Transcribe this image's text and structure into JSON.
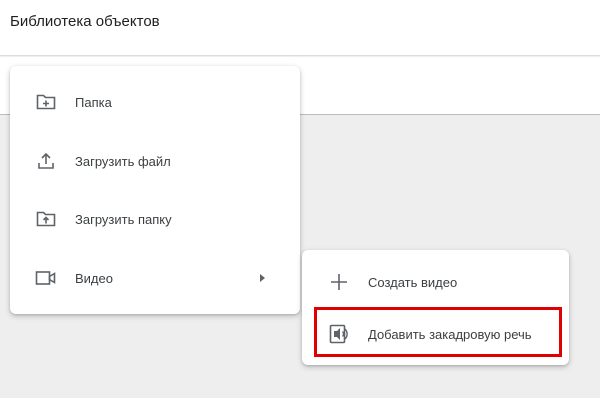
{
  "header": {
    "title": "Библиотека объектов"
  },
  "main_menu": {
    "items": [
      {
        "label": "Папка",
        "icon": "folder-plus-icon"
      },
      {
        "label": "Загрузить файл",
        "icon": "upload-icon"
      },
      {
        "label": "Загрузить папку",
        "icon": "folder-upload-icon"
      },
      {
        "label": "Видео",
        "icon": "video-icon",
        "has_submenu": true
      }
    ]
  },
  "sub_menu": {
    "items": [
      {
        "label": "Создать видео",
        "icon": "plus-icon"
      },
      {
        "label": "Добавить закадровую речь",
        "icon": "voiceover-icon",
        "highlighted": true
      }
    ]
  },
  "colors": {
    "highlight_border": "#e00000",
    "icon": "#5f6368",
    "text": "#3c4043",
    "background": "#eeeeee"
  }
}
